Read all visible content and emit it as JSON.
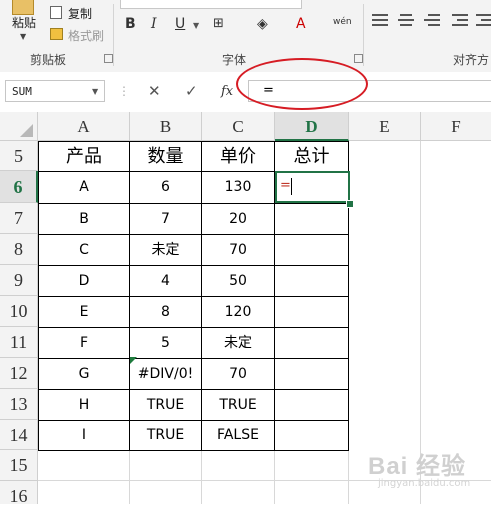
{
  "ribbon": {
    "clipboard": {
      "paste_label": "粘贴",
      "copy_label": "复制",
      "format_painter_label": "格式刷",
      "group_label": "剪贴板"
    },
    "font": {
      "group_label": "字体",
      "bold_label": "B",
      "italic_label": "I",
      "underline_label": "U",
      "phonetic_label": "wén"
    },
    "alignment": {
      "group_label": "对齐方"
    }
  },
  "formula_bar": {
    "name_box": "SUM",
    "cancel_glyph": "✕",
    "enter_glyph": "✓",
    "fx_label": "fx",
    "content": "="
  },
  "grid": {
    "columns": [
      "A",
      "B",
      "C",
      "D",
      "E",
      "F"
    ],
    "active_column": "D",
    "rows": [
      "5",
      "6",
      "7",
      "8",
      "9",
      "10",
      "11",
      "12",
      "13",
      "14",
      "15",
      "16"
    ],
    "active_row": "6",
    "header_row": [
      "产品",
      "数量",
      "单价",
      "总计"
    ],
    "data": [
      [
        "A",
        "6",
        "130",
        "="
      ],
      [
        "B",
        "7",
        "20",
        ""
      ],
      [
        "C",
        "未定",
        "70",
        ""
      ],
      [
        "D",
        "4",
        "50",
        ""
      ],
      [
        "E",
        "8",
        "120",
        ""
      ],
      [
        "F",
        "5",
        "未定",
        ""
      ],
      [
        "G",
        "#DIV/0!",
        "70",
        ""
      ],
      [
        "H",
        "TRUE",
        "TRUE",
        ""
      ],
      [
        "I",
        "TRUE",
        "FALSE",
        ""
      ]
    ]
  },
  "watermark": {
    "brand": "Bai 经验",
    "url": "jingyan.baidu.com"
  },
  "colors": {
    "accent": "#217346",
    "annotation": "#d61c24",
    "formula_text": "#c0392b"
  }
}
